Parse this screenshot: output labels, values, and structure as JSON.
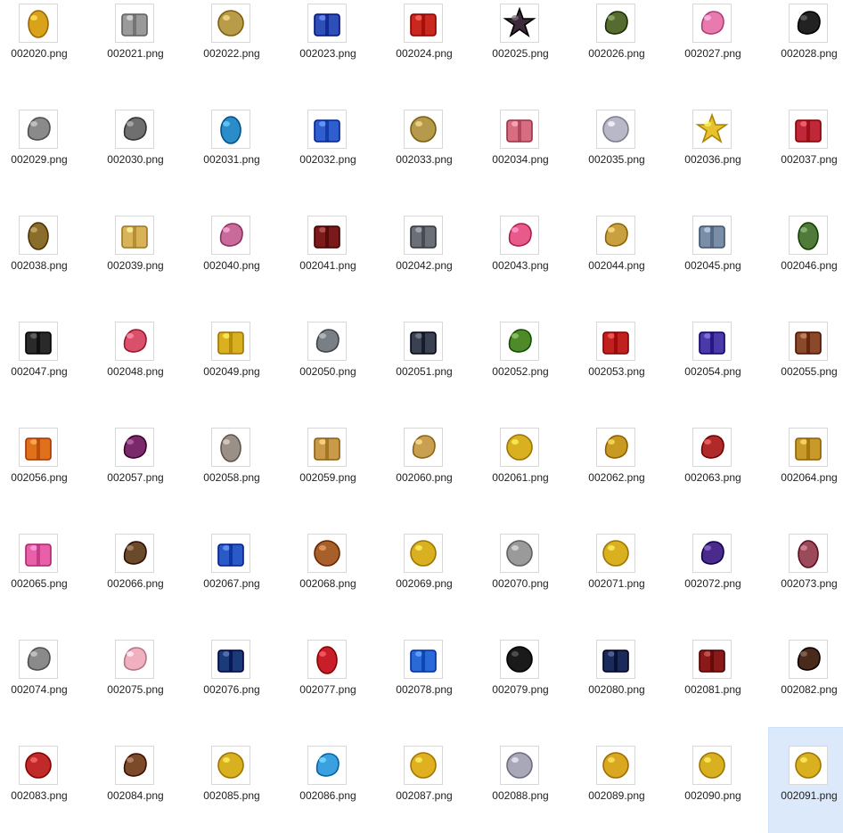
{
  "folder": {
    "selected_index": 71,
    "files": [
      {
        "name": "002020.png",
        "icon": "golden-egg-icon",
        "color": "#d9a21b"
      },
      {
        "name": "002021.png",
        "icon": "silver-flower-box-icon",
        "color": "#9a9a9a"
      },
      {
        "name": "002022.png",
        "icon": "coin-stack-icon",
        "color": "#b89c4a"
      },
      {
        "name": "002023.png",
        "icon": "blue-white-box-icon",
        "color": "#2e4fb8"
      },
      {
        "name": "002024.png",
        "icon": "red-gift-box-icon",
        "color": "#c8281e"
      },
      {
        "name": "002025.png",
        "icon": "dark-star-icon",
        "color": "#3a2a3a"
      },
      {
        "name": "002026.png",
        "icon": "event-badge-icon",
        "color": "#556b2f"
      },
      {
        "name": "002027.png",
        "icon": "candy-bundle-icon",
        "color": "#e87ab0"
      },
      {
        "name": "002028.png",
        "icon": "sunglasses-icon",
        "color": "#222222"
      },
      {
        "name": "002029.png",
        "icon": "horseshoe-icon",
        "color": "#8a8a8a"
      },
      {
        "name": "002030.png",
        "icon": "skeleton-arm-icon",
        "color": "#6f6f6f"
      },
      {
        "name": "002031.png",
        "icon": "blue-pattern-egg-icon",
        "color": "#2a8cc8"
      },
      {
        "name": "002032.png",
        "icon": "blue-gift-box-icon",
        "color": "#2f5fcf"
      },
      {
        "name": "002033.png",
        "icon": "coin-pile-icon",
        "color": "#b59a4c"
      },
      {
        "name": "002034.png",
        "icon": "pink-flower-chest-icon",
        "color": "#d76d80"
      },
      {
        "name": "002035.png",
        "icon": "third-place-balloon-icon",
        "color": "#b8b8c8"
      },
      {
        "name": "002036.png",
        "icon": "gold-stars-icon",
        "color": "#e7c12e"
      },
      {
        "name": "002037.png",
        "icon": "heart-chocolate-box-icon",
        "color": "#c0283a"
      },
      {
        "name": "002038.png",
        "icon": "seed-icon",
        "color": "#8a6d2a"
      },
      {
        "name": "002039.png",
        "icon": "lucky-ticket-icon",
        "color": "#d9b35a"
      },
      {
        "name": "002040.png",
        "icon": "flower-basket-icon",
        "color": "#c86a9a"
      },
      {
        "name": "002041.png",
        "icon": "dark-red-gift-icon",
        "color": "#7a1a1a"
      },
      {
        "name": "002042.png",
        "icon": "steel-chest-icon",
        "color": "#6a6f78"
      },
      {
        "name": "002043.png",
        "icon": "lollipops-icon",
        "color": "#e85a8a"
      },
      {
        "name": "002044.png",
        "icon": "golden-potion-icon",
        "color": "#c9a040"
      },
      {
        "name": "002045.png",
        "icon": "treasure-chest-icon",
        "color": "#7a8ea8"
      },
      {
        "name": "002046.png",
        "icon": "green-leaf-seed-icon",
        "color": "#4f7a3a"
      },
      {
        "name": "002047.png",
        "icon": "iron-ingot-icon",
        "color": "#2a2a2a"
      },
      {
        "name": "002048.png",
        "icon": "wrapped-candies-icon",
        "color": "#d8506a"
      },
      {
        "name": "002049.png",
        "icon": "gold-chest-icon",
        "color": "#d9b020"
      },
      {
        "name": "002050.png",
        "icon": "silver-necklace-icon",
        "color": "#7a7f86"
      },
      {
        "name": "002051.png",
        "icon": "dark-gift-box-icon",
        "color": "#3a4150"
      },
      {
        "name": "002052.png",
        "icon": "sprout-icon",
        "color": "#4f8a2a"
      },
      {
        "name": "002053.png",
        "icon": "christmas-gift-icon",
        "color": "#c0201e"
      },
      {
        "name": "002054.png",
        "icon": "purple-gift-box-icon",
        "color": "#4a3aa8"
      },
      {
        "name": "002055.png",
        "icon": "wooden-chest-icon",
        "color": "#8a4a2a"
      },
      {
        "name": "002056.png",
        "icon": "orange-treasure-chest-icon",
        "color": "#e0701a"
      },
      {
        "name": "002057.png",
        "icon": "purple-pouch-icon",
        "color": "#7a2a6a"
      },
      {
        "name": "002058.png",
        "icon": "grey-seed-icon",
        "color": "#9a9088"
      },
      {
        "name": "002059.png",
        "icon": "toy-box-icon",
        "color": "#c89a4a"
      },
      {
        "name": "002060.png",
        "icon": "straw-hat-icon",
        "color": "#c9a050"
      },
      {
        "name": "002061.png",
        "icon": "gold-coin-1000-icon",
        "color": "#d9b020"
      },
      {
        "name": "002062.png",
        "icon": "gold-trophy-icon",
        "color": "#c89a20"
      },
      {
        "name": "002063.png",
        "icon": "christmas-sock-icon",
        "color": "#b02a2a"
      },
      {
        "name": "002064.png",
        "icon": "gold-wooden-chest-icon",
        "color": "#c99a2a"
      },
      {
        "name": "002065.png",
        "icon": "pink-flower-gift-icon",
        "color": "#e860a8"
      },
      {
        "name": "002066.png",
        "icon": "logs-crystal-icon",
        "color": "#6a4a2a"
      },
      {
        "name": "002067.png",
        "icon": "mystery-blue-box-icon",
        "color": "#2a5ac8"
      },
      {
        "name": "002068.png",
        "icon": "bronze-coin-icon",
        "color": "#a8602a"
      },
      {
        "name": "002069.png",
        "icon": "gold-coin-icon",
        "color": "#d9b020"
      },
      {
        "name": "002070.png",
        "icon": "silver-coin-icon",
        "color": "#9a9a9a"
      },
      {
        "name": "002071.png",
        "icon": "gold-coin-100-icon",
        "color": "#d9b020"
      },
      {
        "name": "002072.png",
        "icon": "pumpkin-witch-hat-icon",
        "color": "#4a2a8a"
      },
      {
        "name": "002073.png",
        "icon": "red-seed-icon",
        "color": "#9a4a5a"
      },
      {
        "name": "002074.png",
        "icon": "silver-trophy-icon",
        "color": "#8a8a8a"
      },
      {
        "name": "002075.png",
        "icon": "cherry-blossom-icon",
        "color": "#f0b0c0"
      },
      {
        "name": "002076.png",
        "icon": "mystery-dark-chest-icon",
        "color": "#1a3a7a"
      },
      {
        "name": "002077.png",
        "icon": "red-ribbon-egg-icon",
        "color": "#c81e2a"
      },
      {
        "name": "002078.png",
        "icon": "blue-ribbon-gift-icon",
        "color": "#2a6ad8"
      },
      {
        "name": "002079.png",
        "icon": "soccer-ball-icon",
        "color": "#1a1a1a"
      },
      {
        "name": "002080.png",
        "icon": "navy-chest-icon",
        "color": "#1a2a5a"
      },
      {
        "name": "002081.png",
        "icon": "red-gold-chest-icon",
        "color": "#8a1a1a"
      },
      {
        "name": "002082.png",
        "icon": "coffee-beans-icon",
        "color": "#4a2a1a"
      },
      {
        "name": "002083.png",
        "icon": "whistle-ball-icon",
        "color": "#c02a2a"
      },
      {
        "name": "002084.png",
        "icon": "wood-logs-icon",
        "color": "#7a4a2a"
      },
      {
        "name": "002085.png",
        "icon": "first-place-coin-icon",
        "color": "#d9b020"
      },
      {
        "name": "002086.png",
        "icon": "tropical-drink-icon",
        "color": "#3aa0e0"
      },
      {
        "name": "002087.png",
        "icon": "third-place-gold-balloon-icon",
        "color": "#e0b020"
      },
      {
        "name": "002088.png",
        "icon": "second-place-balloon-icon",
        "color": "#a8a8b8"
      },
      {
        "name": "002089.png",
        "icon": "gold-coin-pile-icon",
        "color": "#d9a820"
      },
      {
        "name": "002090.png",
        "icon": "b-coin-icon",
        "color": "#d9b020"
      },
      {
        "name": "002091.png",
        "icon": "first-place-coin-icon",
        "color": "#d9b020"
      }
    ]
  }
}
